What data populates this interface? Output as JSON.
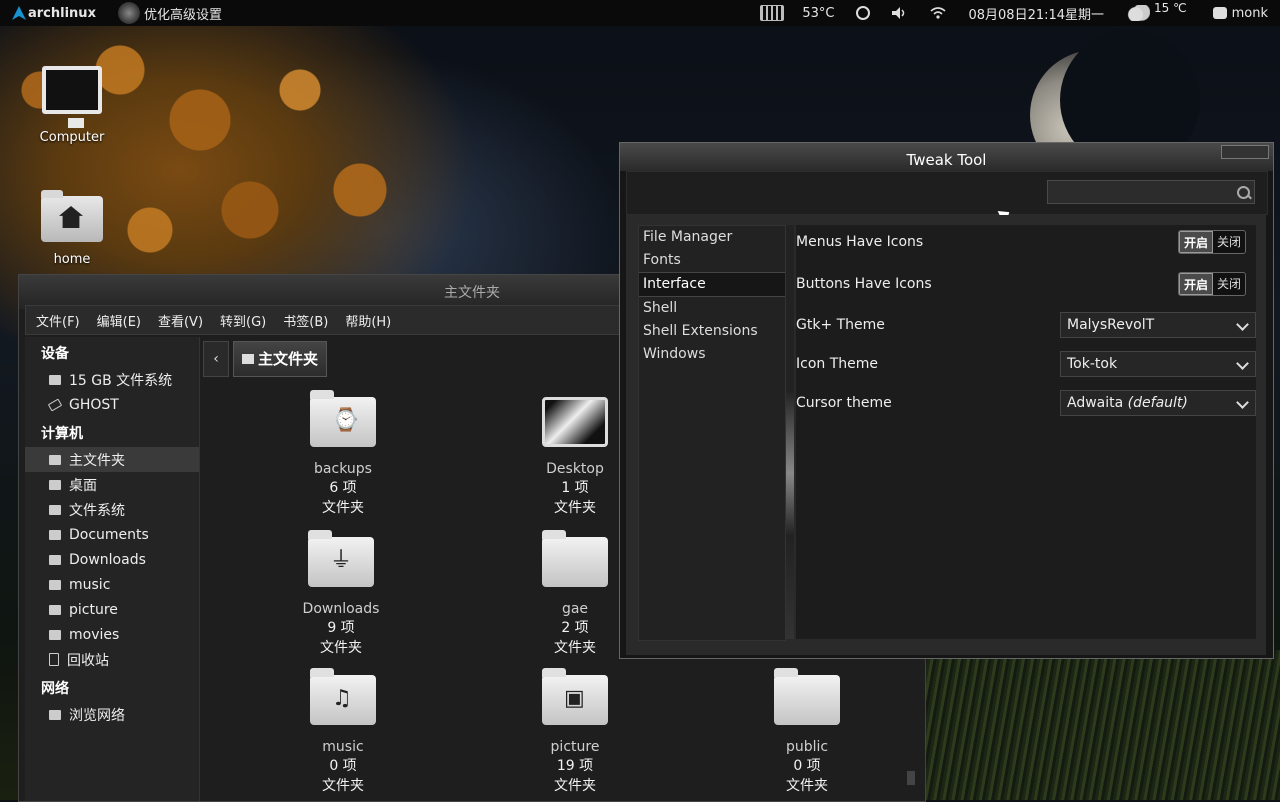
{
  "panel": {
    "distro_label": "archlinux",
    "active_app": "优化高级设置",
    "cpu_temp": "53°C",
    "clock": "08月08日21:14星期一",
    "weather_temp": "15 ℃",
    "user": "monk"
  },
  "desktop": {
    "icons": [
      {
        "label": "Computer",
        "icon": "computer-icon"
      },
      {
        "label": "home",
        "icon": "home-folder-icon"
      }
    ]
  },
  "file_manager": {
    "title": "主文件夹",
    "menu": [
      "文件(F)",
      "编辑(E)",
      "查看(V)",
      "转到(G)",
      "书签(B)",
      "帮助(H)"
    ],
    "sidebar": {
      "devices_header": "设备",
      "devices": [
        "15 GB 文件系统",
        "GHOST"
      ],
      "computer_header": "计算机",
      "places": [
        "主文件夹",
        "桌面",
        "文件系统",
        "Documents",
        "Downloads",
        "music",
        "picture",
        "movies",
        "回收站"
      ],
      "network_header": "网络",
      "network": [
        "浏览网络"
      ]
    },
    "path_back": "‹",
    "path_current": "主文件夹",
    "items": [
      {
        "name": "backups",
        "count": "6 项",
        "type": "文件夹",
        "emblem": "clock"
      },
      {
        "name": "Desktop",
        "count": "1 项",
        "type": "文件夹",
        "emblem": "desktop"
      },
      {
        "name": "Downloads",
        "count": "9 项",
        "type": "文件夹",
        "emblem": "download"
      },
      {
        "name": "gae",
        "count": "2 项",
        "type": "文件夹",
        "emblem": "none"
      },
      {
        "name": "music",
        "count": "0 项",
        "type": "文件夹",
        "emblem": "music"
      },
      {
        "name": "picture",
        "count": "19 项",
        "type": "文件夹",
        "emblem": "picture"
      },
      {
        "name": "public",
        "count": "0 项",
        "type": "文件夹",
        "emblem": "none"
      }
    ]
  },
  "tweak_tool": {
    "title": "Tweak Tool",
    "search_placeholder": "",
    "categories": [
      "File Manager",
      "Fonts",
      "Interface",
      "Shell",
      "Shell Extensions",
      "Windows"
    ],
    "active_category": "Interface",
    "settings": {
      "menus_have_icons": {
        "label": "Menus Have Icons",
        "on": "开启",
        "off": "关闭",
        "state": "on"
      },
      "buttons_have_icons": {
        "label": "Buttons Have Icons",
        "on": "开启",
        "off": "关闭",
        "state": "on"
      },
      "gtk_theme": {
        "label": "Gtk+ Theme",
        "value": "MalysRevolT"
      },
      "icon_theme": {
        "label": "Icon Theme",
        "value": "Tok-tok"
      },
      "cursor_theme": {
        "label": "Cursor theme",
        "value": "Adwaita",
        "value_suffix": "(default)"
      }
    }
  }
}
